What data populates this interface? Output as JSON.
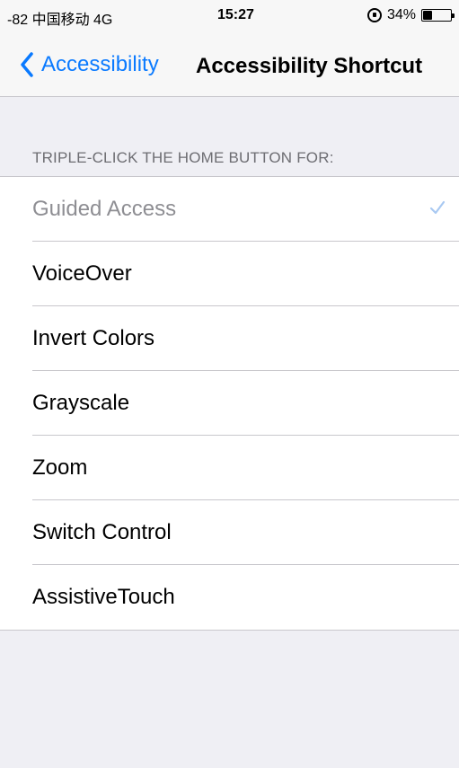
{
  "status_bar": {
    "carrier": "-82 中国移动 4G",
    "time": "15:27",
    "battery": "34%",
    "battery_level": 0.34,
    "rotation_lock_icon": "rotation-lock-icon"
  },
  "nav": {
    "back_label": "Accessibility",
    "title": "Accessibility Shortcut",
    "accent_color": "#0a7aff"
  },
  "section": {
    "header": "TRIPLE-CLICK THE HOME BUTTON FOR:"
  },
  "options": [
    {
      "label": "Guided Access",
      "selected": true,
      "disabled": true
    },
    {
      "label": "VoiceOver",
      "selected": false,
      "disabled": false
    },
    {
      "label": "Invert Colors",
      "selected": false,
      "disabled": false
    },
    {
      "label": "Grayscale",
      "selected": false,
      "disabled": false
    },
    {
      "label": "Zoom",
      "selected": false,
      "disabled": false
    },
    {
      "label": "Switch Control",
      "selected": false,
      "disabled": false
    },
    {
      "label": "AssistiveTouch",
      "selected": false,
      "disabled": false
    }
  ]
}
